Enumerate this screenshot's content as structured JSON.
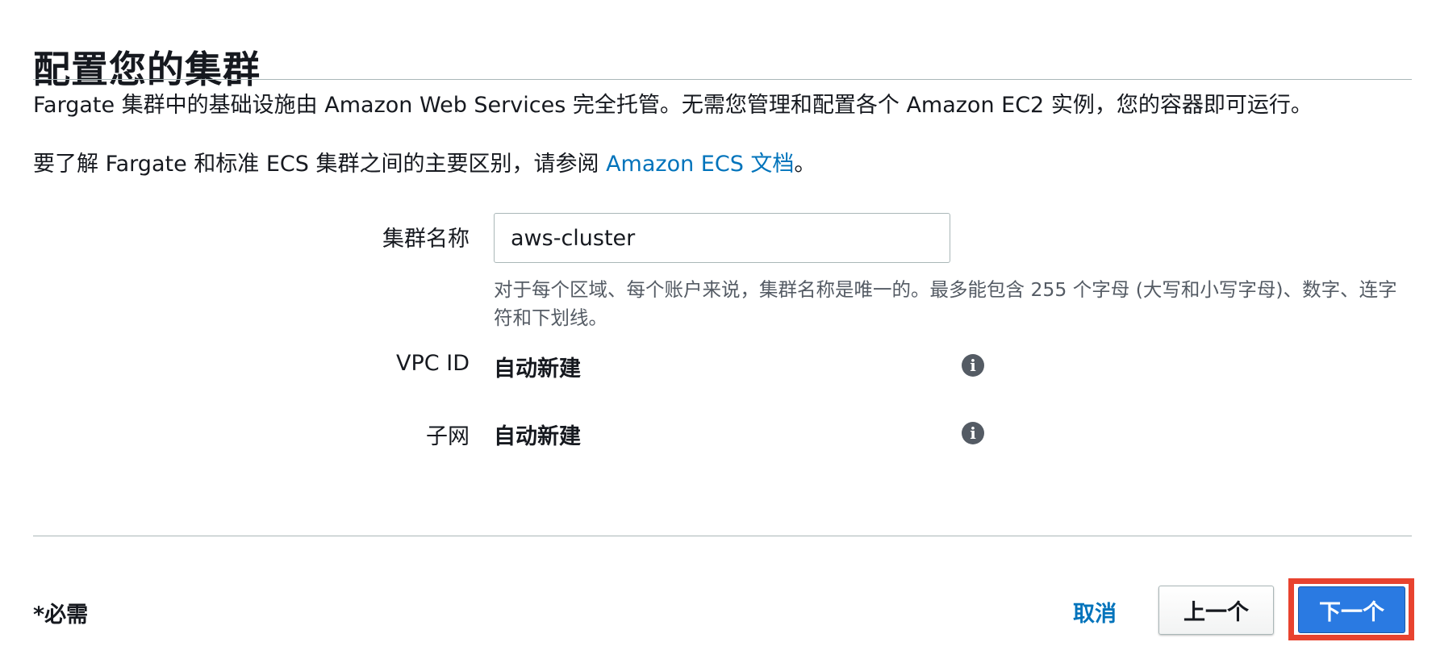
{
  "header": {
    "title": "配置您的集群"
  },
  "intro": {
    "line1": "Fargate 集群中的基础设施由 Amazon Web Services 完全托管。无需您管理和配置各个 Amazon EC2 实例，您的容器即可运行。",
    "line2_prefix": "要了解 Fargate 和标准 ECS 集群之间的主要区别，请参阅 ",
    "line2_link": "Amazon ECS 文档",
    "line2_suffix": "。"
  },
  "form": {
    "cluster_name": {
      "label": "集群名称",
      "value": "aws-cluster",
      "hint": "对于每个区域、每个账户来说，集群名称是唯一的。最多能包含 255 个字母 (大写和小写字母)、数字、连字符和下划线。"
    },
    "vpc": {
      "label": "VPC ID",
      "value": "自动新建",
      "icon": "info-icon"
    },
    "subnet": {
      "label": "子网",
      "value": "自动新建",
      "icon": "info-icon"
    }
  },
  "footer": {
    "required_note": "*必需",
    "cancel_label": "取消",
    "prev_label": "上一个",
    "next_label": "下一个"
  },
  "colors": {
    "link": "#0073bb",
    "primary_button": "#2a7ae2",
    "highlight": "#e8432f"
  }
}
